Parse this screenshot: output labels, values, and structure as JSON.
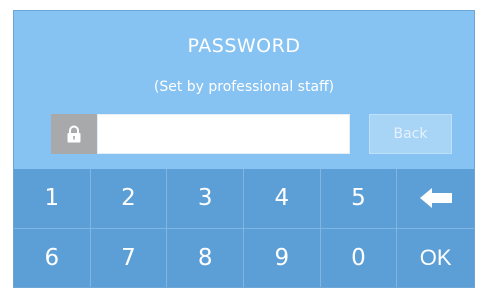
{
  "header": {
    "title": "PASSWORD",
    "subtitle": "(Set by professional staff)"
  },
  "password_input": {
    "value": "",
    "lock_icon": "lock-icon"
  },
  "back_button": {
    "label": "Back"
  },
  "keypad": {
    "row1": [
      "1",
      "2",
      "3",
      "4",
      "5"
    ],
    "row1_icon": "backspace-arrow-icon",
    "row2": [
      "6",
      "7",
      "8",
      "9",
      "0",
      "OK"
    ]
  },
  "colors": {
    "panel": "#87c3f2",
    "keypad": "#5b9fd6",
    "lock_box": "#a8a9ab",
    "back_button": "#a8d4f6"
  }
}
